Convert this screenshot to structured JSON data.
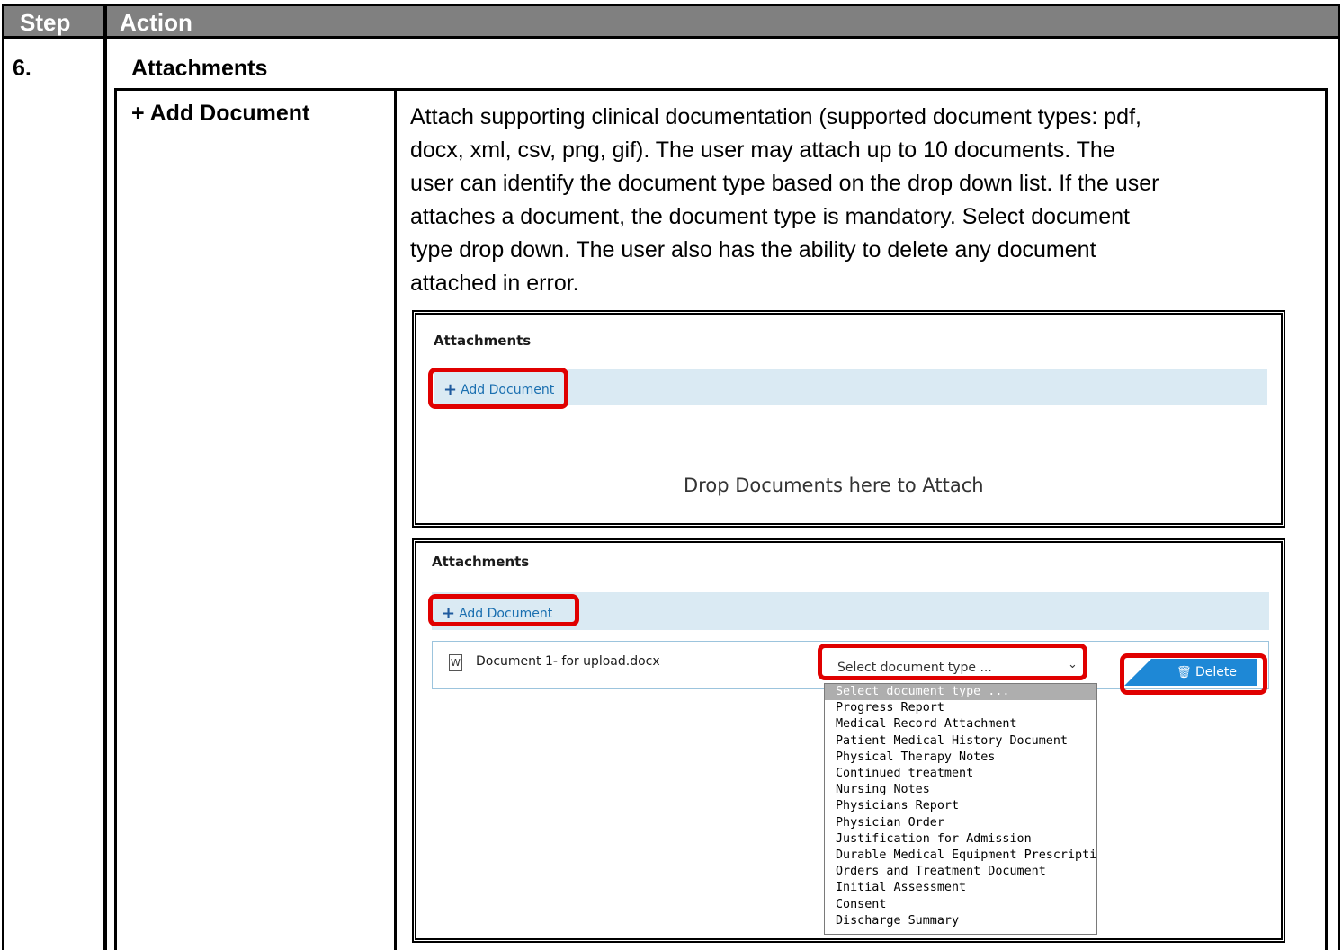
{
  "table": {
    "header": {
      "step": "Step",
      "action": "Action"
    },
    "row": {
      "step_number": "6.",
      "section_title": "Attachments",
      "sub_label": "+ Add Document",
      "description_lines": [
        "Attach supporting clinical documentation (supported document types: pdf,",
        "docx, xml, csv, png, gif). The user may attach up to 10 documents. The",
        "user can identify the document type based on the drop down list. If the user",
        "attaches a document, the document type is mandatory. Select document",
        "type drop down. The user also has the ability to delete any document",
        "attached in error."
      ]
    }
  },
  "screenshot1": {
    "title": "Attachments",
    "add_document_label": "Add Document",
    "drop_zone_text": "Drop Documents here to Attach"
  },
  "screenshot2": {
    "title": "Attachments",
    "add_document_label": "Add Document",
    "file_name": "Document 1- for upload.docx",
    "select_value": "Select document type ...",
    "delete_label": "Delete",
    "options": [
      "Select document type ...",
      "Progress Report",
      "Medical Record Attachment",
      "Patient Medical History Document",
      "Physical Therapy Notes",
      "Continued treatment",
      "Nursing Notes",
      "Physicians Report",
      "Physician Order",
      "Justification for Admission",
      "Durable Medical Equipment Prescription",
      "Orders and Treatment Document",
      "Initial Assessment",
      "Consent",
      "Discharge Summary"
    ]
  },
  "colors": {
    "header_bg": "#808080",
    "highlight_red": "#e00000",
    "toolbar_bg": "#daeaf3",
    "link_blue": "#1a6fb0",
    "delete_button_bg": "#1e88d6",
    "dropdown_selected_bg": "#aeaeae"
  },
  "icons": {
    "add": "plus-icon",
    "file": "word-document-icon",
    "dropdown": "chevron-down-icon",
    "delete": "trash-icon"
  }
}
